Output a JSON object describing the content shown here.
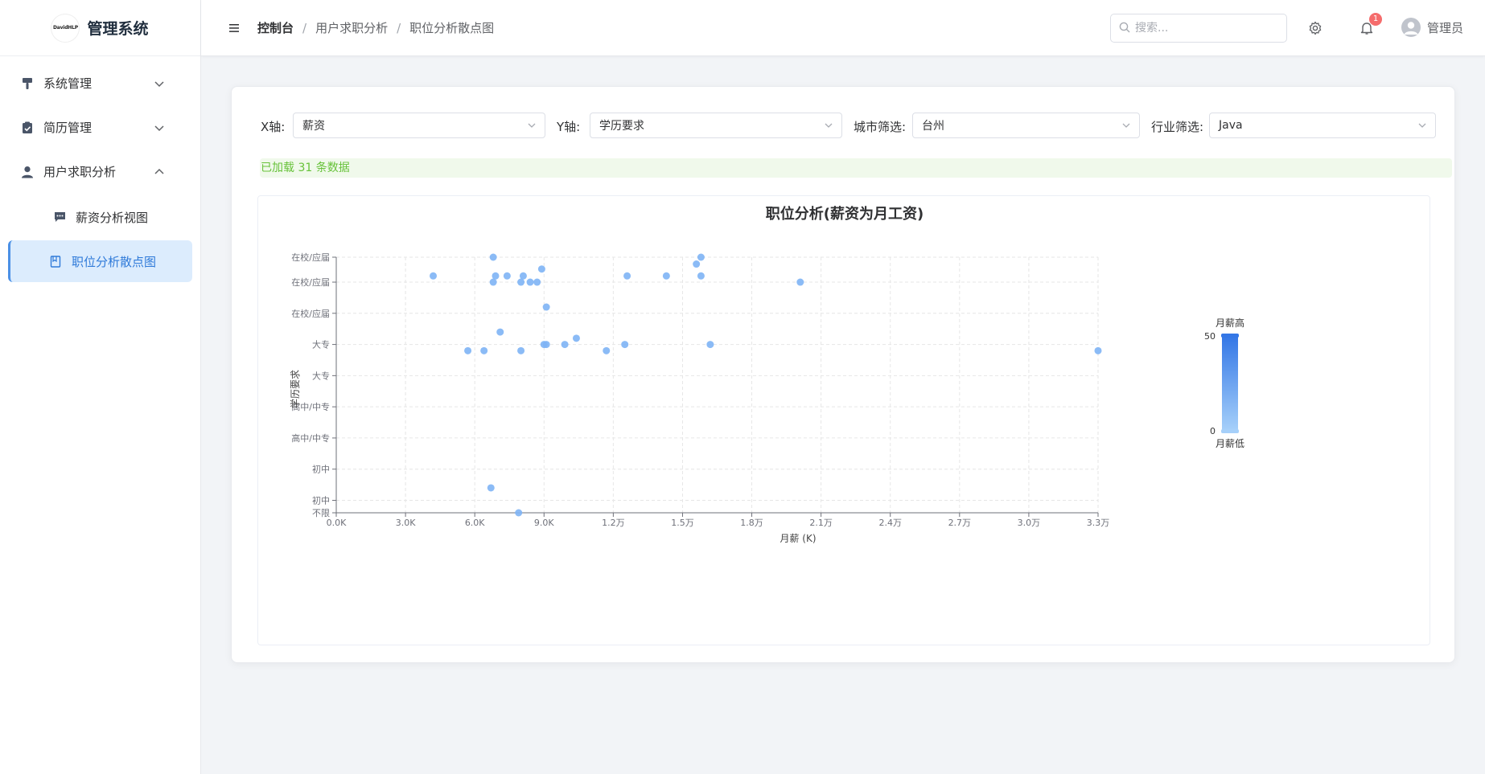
{
  "brand": {
    "logo_text": "DavidHLP",
    "title": "管理系统"
  },
  "sidebar": {
    "items": [
      {
        "label": "系统管理",
        "icon": "brush-icon",
        "expanded": false
      },
      {
        "label": "简历管理",
        "icon": "clipboard-check-icon",
        "expanded": false
      },
      {
        "label": "用户求职分析",
        "icon": "user-icon",
        "expanded": true,
        "children": [
          {
            "label": "薪资分析视图",
            "icon": "chat-icon",
            "active": false
          },
          {
            "label": "职位分析散点图",
            "icon": "notebook-icon",
            "active": true
          }
        ]
      }
    ]
  },
  "header": {
    "breadcrumb": [
      "控制台",
      "用户求职分析",
      "职位分析散点图"
    ],
    "search_placeholder": "搜索...",
    "notification_count": "1",
    "user_name": "管理员"
  },
  "filters": {
    "x_label": "X轴:",
    "x_value": "薪资",
    "y_label": "Y轴:",
    "y_value": "学历要求",
    "city_label": "城市筛选:",
    "city_value": "台州",
    "industry_label": "行业筛选:",
    "industry_value": "Java"
  },
  "status": {
    "loaded_text": "已加载 31 条数据"
  },
  "colors": {
    "accent": "#409eff",
    "point": "#7eb4f5",
    "visual_high": "#3477e6",
    "visual_low": "#a6d0fa",
    "success": "#67c23a"
  },
  "chart_data": {
    "type": "scatter",
    "title": "职位分析(薪资为月工资)",
    "xlabel": "月薪 (K)",
    "ylabel": "学历要求",
    "xlim": [
      0,
      33000
    ],
    "x_ticks": [
      "0.0K",
      "3.0K",
      "6.0K",
      "9.0K",
      "1.2万",
      "1.5万",
      "1.8万",
      "2.1万",
      "2.4万",
      "2.7万",
      "3.0万",
      "3.3万"
    ],
    "ylim": [
      0,
      8.2
    ],
    "y_ticks": [
      {
        "v": 0,
        "label": "不限"
      },
      {
        "v": 0.4,
        "label": "初中"
      },
      {
        "v": 1.4,
        "label": "初中"
      },
      {
        "v": 2.4,
        "label": "高中/中专"
      },
      {
        "v": 3.4,
        "label": "高中/中专"
      },
      {
        "v": 4.4,
        "label": "大专"
      },
      {
        "v": 5.4,
        "label": "大专"
      },
      {
        "v": 6.4,
        "label": "在校/应届"
      },
      {
        "v": 7.4,
        "label": "在校/应届"
      },
      {
        "v": 8.2,
        "label": "在校/应届"
      }
    ],
    "grid": true,
    "points": [
      [
        6800,
        8.2
      ],
      [
        15800,
        8.2
      ],
      [
        15600,
        7.98
      ],
      [
        8900,
        7.82
      ],
      [
        4200,
        7.6
      ],
      [
        6900,
        7.6
      ],
      [
        7400,
        7.6
      ],
      [
        8100,
        7.6
      ],
      [
        12600,
        7.6
      ],
      [
        14300,
        7.6
      ],
      [
        15800,
        7.6
      ],
      [
        6800,
        7.4
      ],
      [
        8000,
        7.4
      ],
      [
        8400,
        7.4
      ],
      [
        8700,
        7.4
      ],
      [
        20100,
        7.4
      ],
      [
        9100,
        6.6
      ],
      [
        7100,
        5.8
      ],
      [
        10400,
        5.6
      ],
      [
        9000,
        5.4
      ],
      [
        9100,
        5.4
      ],
      [
        9900,
        5.4
      ],
      [
        12500,
        5.4
      ],
      [
        16200,
        5.4
      ],
      [
        5700,
        5.2
      ],
      [
        6400,
        5.2
      ],
      [
        8000,
        5.2
      ],
      [
        11700,
        5.2
      ],
      [
        33000,
        5.2
      ],
      [
        6700,
        0.8
      ],
      [
        7900,
        0.0
      ]
    ],
    "visual_map": {
      "max": 50,
      "min": 0,
      "high_label": "月薪高",
      "low_label": "月薪低",
      "max_text": "50",
      "min_text": "0"
    }
  }
}
